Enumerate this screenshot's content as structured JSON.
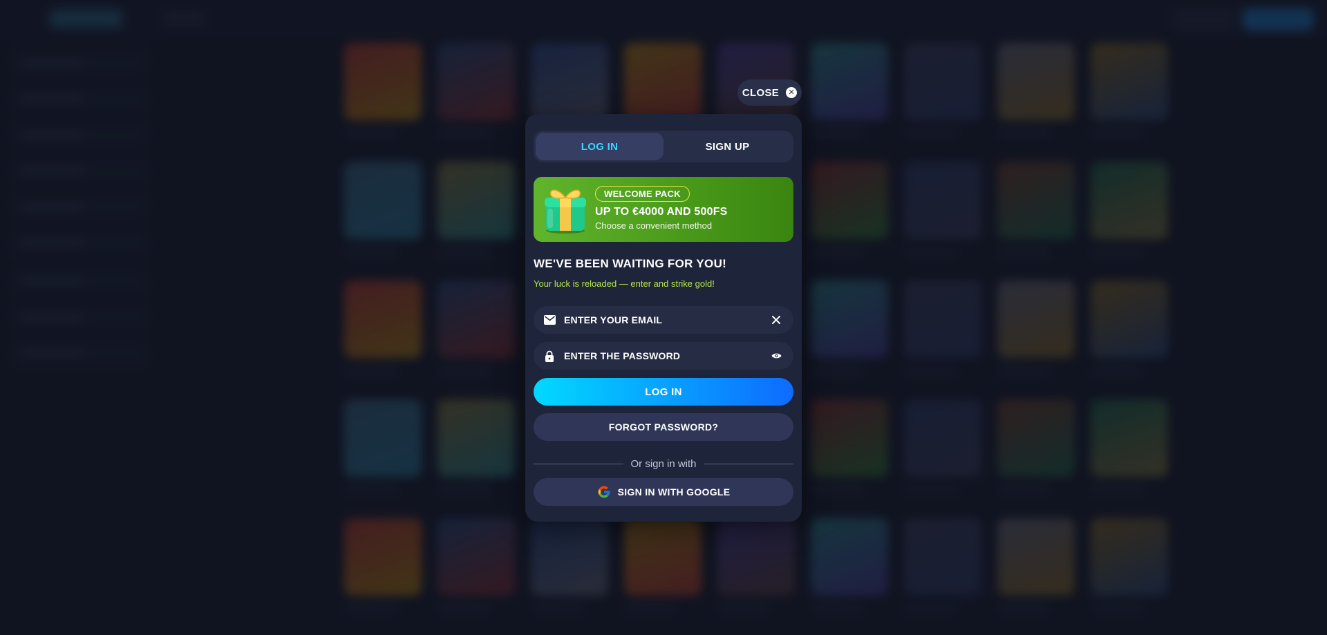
{
  "close": {
    "label": "CLOSE"
  },
  "tabs": [
    {
      "label": "LOG IN",
      "active": true
    },
    {
      "label": "SIGN UP",
      "active": false
    }
  ],
  "promo": {
    "badge": "WELCOME PACK",
    "title": "UP TO €4000 AND 500FS",
    "subtitle": "Choose a convenient method"
  },
  "form": {
    "heading": "WE'VE BEEN WAITING FOR YOU!",
    "subheading": "Your luck is reloaded — enter and strike gold!",
    "email_placeholder": "ENTER YOUR EMAIL",
    "email_value": "",
    "password_placeholder": "ENTER THE PASSWORD",
    "password_value": "",
    "login_label": "LOG IN",
    "forgot_label": "FORGOT PASSWORD?",
    "divider_text": "Or sign in with",
    "google_label": "SIGN IN WITH GOOGLE"
  },
  "icons": {
    "close": "close-icon",
    "email": "envelope-icon",
    "clear": "clear-x-icon",
    "password": "lock-icon",
    "toggle": "eye-icon",
    "google": "google-icon",
    "gift": "gift-icon"
  },
  "colors": {
    "modal_bg": "#1e2439",
    "active_tab_text": "#3ad6ff",
    "promo_green": "#4a9b1a",
    "subheading": "#b6e84a",
    "primary_start": "#02d9ff",
    "primary_end": "#0e6bff"
  }
}
